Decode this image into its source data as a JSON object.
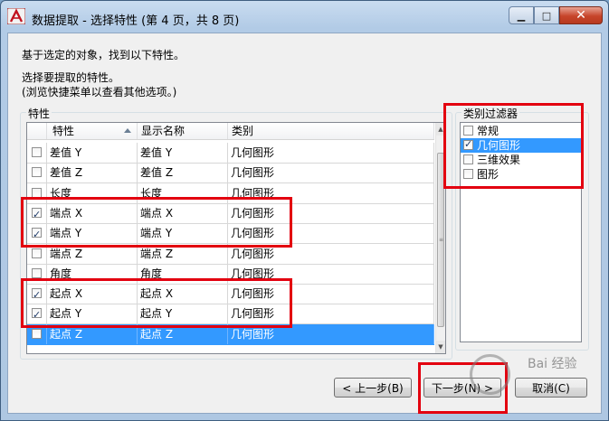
{
  "window": {
    "title": "数据提取 - 选择特性 (第 4 页，共 8 页)",
    "minimize": "▁",
    "maximize": "□",
    "close": "✕"
  },
  "intro": {
    "line1": "基于选定的对象，找到以下特性。",
    "line2": "选择要提取的特性。",
    "line3": "(浏览快捷菜单以查看其他选项。)"
  },
  "properties": {
    "group_label": "特性",
    "columns": [
      "特性",
      "显示名称",
      "类别"
    ],
    "rows": [
      {
        "checked": false,
        "property": "差值 Y",
        "display_name": "差值 Y",
        "category": "几何图形",
        "selected": false
      },
      {
        "checked": false,
        "property": "差值 Z",
        "display_name": "差值 Z",
        "category": "几何图形",
        "selected": false
      },
      {
        "checked": false,
        "property": "长度",
        "display_name": "长度",
        "category": "几何图形",
        "selected": false
      },
      {
        "checked": true,
        "property": "端点 X",
        "display_name": "端点 X",
        "category": "几何图形",
        "selected": false
      },
      {
        "checked": true,
        "property": "端点 Y",
        "display_name": "端点 Y",
        "category": "几何图形",
        "selected": false
      },
      {
        "checked": false,
        "property": "端点 Z",
        "display_name": "端点 Z",
        "category": "几何图形",
        "selected": false
      },
      {
        "checked": false,
        "property": "角度",
        "display_name": "角度",
        "category": "几何图形",
        "selected": false
      },
      {
        "checked": true,
        "property": "起点 X",
        "display_name": "起点 X",
        "category": "几何图形",
        "selected": false
      },
      {
        "checked": true,
        "property": "起点 Y",
        "display_name": "起点 Y",
        "category": "几何图形",
        "selected": false
      },
      {
        "checked": false,
        "property": "起点 Z",
        "display_name": "起点 Z",
        "category": "几何图形",
        "selected": true
      }
    ]
  },
  "category_filter": {
    "group_label": "类别过滤器",
    "items": [
      {
        "label": "常规",
        "checked": false,
        "selected": false
      },
      {
        "label": "几何图形",
        "checked": true,
        "selected": true
      },
      {
        "label": "三维效果",
        "checked": false,
        "selected": false
      },
      {
        "label": "图形",
        "checked": false,
        "selected": false
      }
    ]
  },
  "buttons": {
    "back": "< 上一步(B)",
    "next": "下一步(N) >",
    "cancel": "取消(C)"
  },
  "watermark": "Bai 经验",
  "colors": {
    "highlight": "#e3000f",
    "selection": "#3399ff"
  }
}
